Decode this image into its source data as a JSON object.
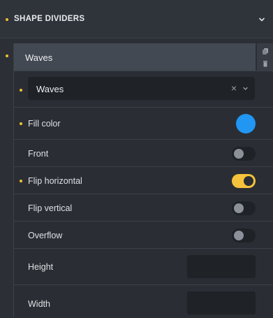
{
  "section": {
    "title": "SHAPE DIVIDERS"
  },
  "item": {
    "title": "Waves"
  },
  "shape_select": {
    "value": "Waves",
    "clear_symbol": "×"
  },
  "fields": {
    "fill_color": {
      "label": "Fill color",
      "color": "#2196f3"
    },
    "front": {
      "label": "Front",
      "on": false
    },
    "flip_horizontal": {
      "label": "Flip horizontal",
      "on": true
    },
    "flip_vertical": {
      "label": "Flip vertical",
      "on": false
    },
    "overflow": {
      "label": "Overflow",
      "on": false
    },
    "height": {
      "label": "Height",
      "value": ""
    },
    "width": {
      "label": "Width",
      "value": ""
    }
  },
  "colors": {
    "accent_toggle": "#f5c33b",
    "modified_dot": "#f1c232"
  },
  "icons": {
    "collapse": "chevron-down-icon",
    "duplicate": "copy-icon",
    "delete": "trash-icon",
    "select_caret": "chevron-down-icon"
  }
}
